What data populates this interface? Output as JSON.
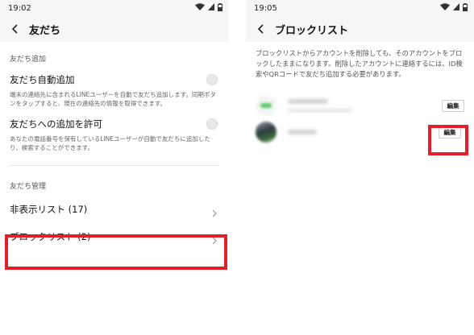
{
  "left_screen": {
    "status_time": "19:02",
    "title": "友だち",
    "section_add": "友だち追加",
    "auto_add": {
      "title": "友だち自動追加",
      "desc": "端末の連絡先に含まれるLINEユーザーを自動で友だち追加します。同期ボタンをタップすると、現在の連絡先の情報を取得できます。"
    },
    "allow_add": {
      "title": "友だちへの追加を許可",
      "desc": "あなたの電話番号を保有しているLINEユーザーが自動で友だちに追加したり、検索することができます。"
    },
    "section_manage": "友だち管理",
    "hidden_list": "非表示リスト (17)",
    "block_list": "ブロックリスト (2)"
  },
  "right_screen": {
    "status_time": "19:05",
    "title": "ブロックリスト",
    "info": "ブロックリストからアカウントを削除しても、そのアカウントをブロックしたままになります。削除したアカウントに連絡するには、ID検索やQRコードで友だち追加する必要があります。",
    "edit_label": "編集"
  },
  "colors": {
    "highlight": "#e3202a"
  }
}
